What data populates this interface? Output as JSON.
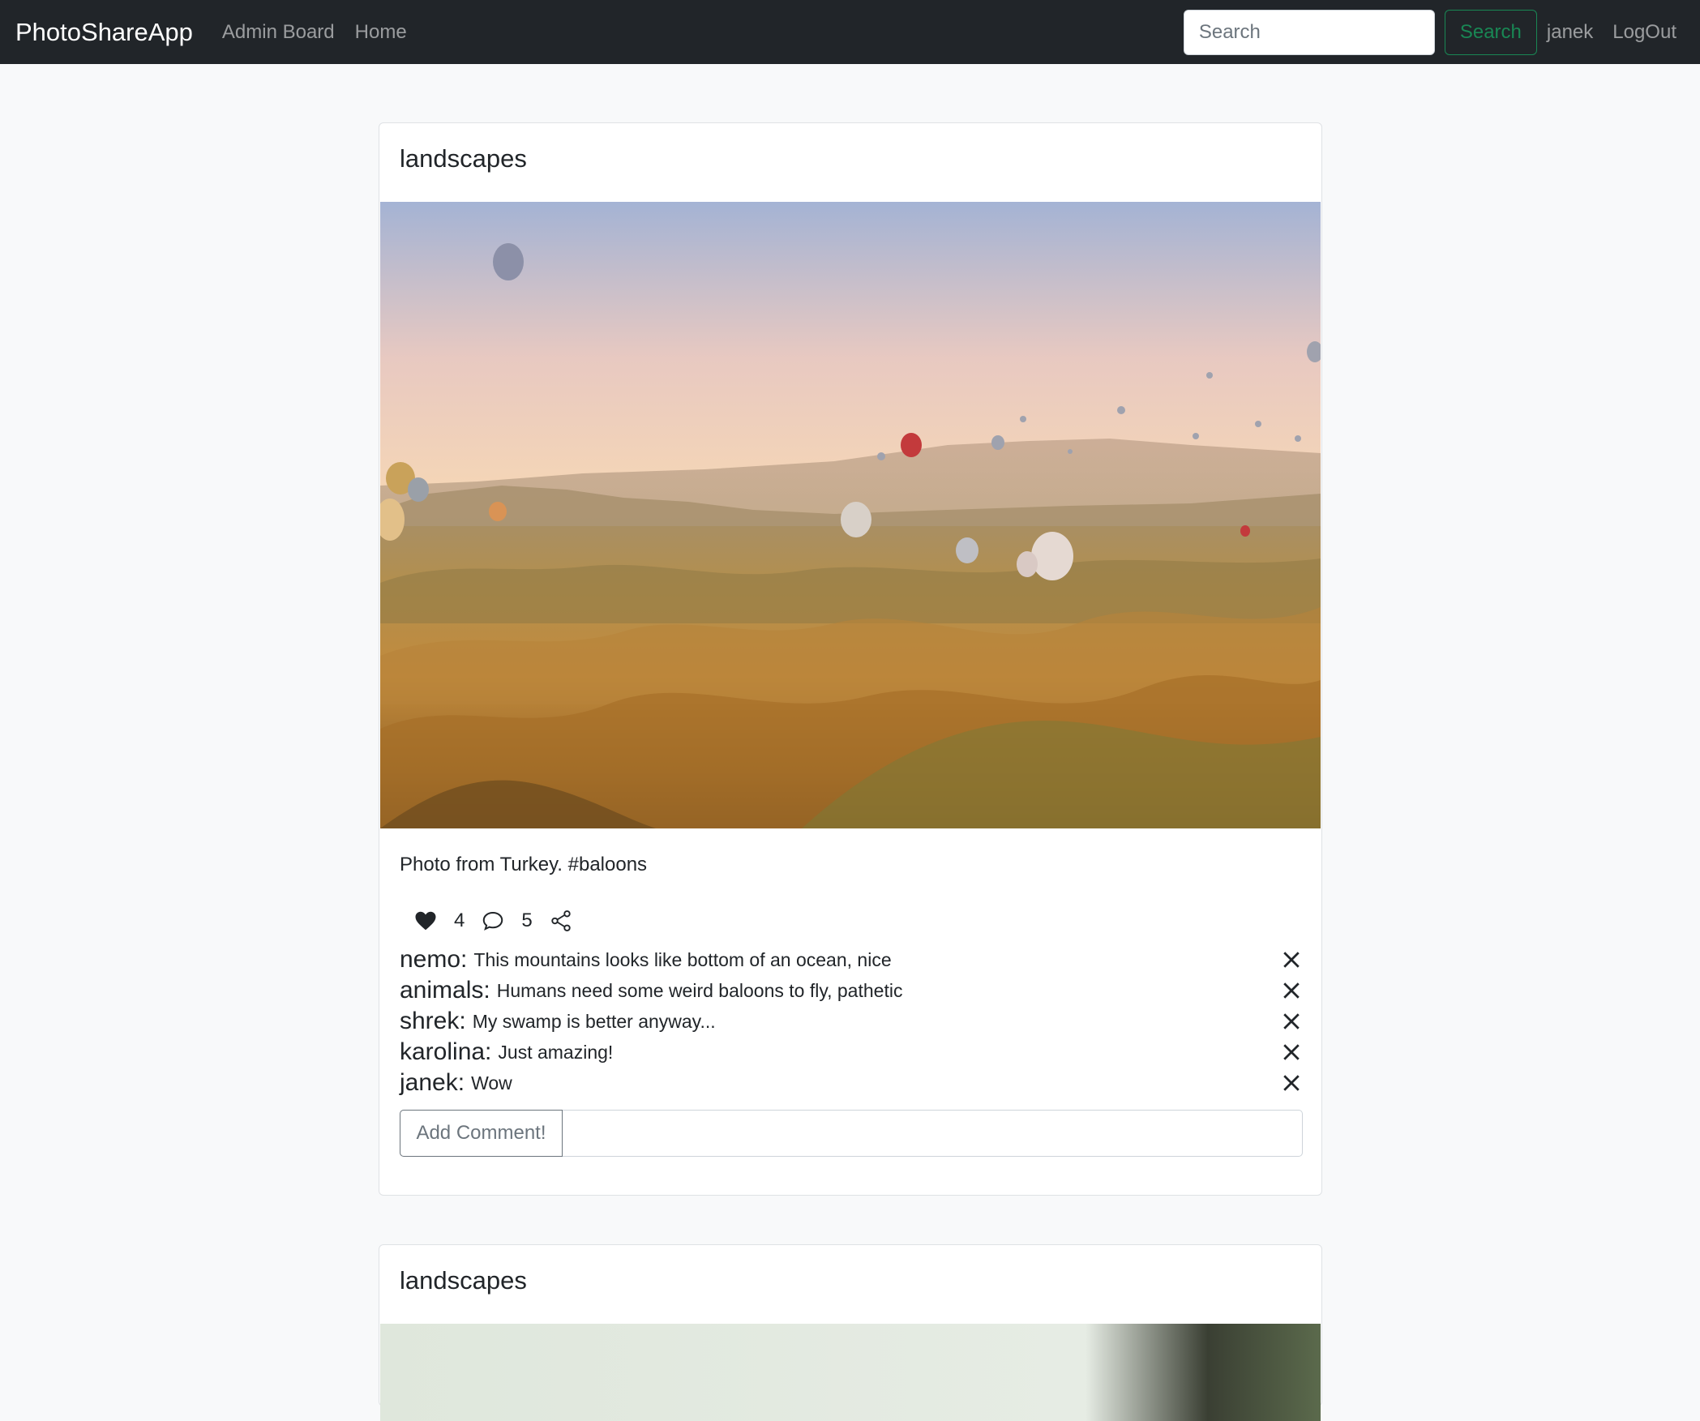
{
  "navbar": {
    "brand": "PhotoShareApp",
    "links": [
      "Admin Board",
      "Home"
    ],
    "search": {
      "placeholder": "Search",
      "value": "",
      "button_label": "Search"
    },
    "username": "janek",
    "logout_label": "LogOut"
  },
  "posts": [
    {
      "title": "landscapes",
      "description": "Photo from Turkey. #baloons",
      "likes": "4",
      "comment_count": "5",
      "comments": [
        {
          "user": "nemo:",
          "text": "This mountains looks like bottom of an ocean, nice"
        },
        {
          "user": "animals:",
          "text": "Humans need some weird baloons to fly, pathetic"
        },
        {
          "user": "shrek:",
          "text": "My swamp is better anyway..."
        },
        {
          "user": "karolina:",
          "text": "Just amazing!"
        },
        {
          "user": "janek:",
          "text": "Wow"
        }
      ],
      "add_comment": {
        "button_label": "Add Comment!",
        "value": ""
      }
    },
    {
      "title": "landscapes"
    }
  ],
  "icons": {
    "like": "heart-icon",
    "comment": "speech-bubble-icon",
    "share": "share-icon",
    "delete": "close-icon"
  },
  "colors": {
    "navbar_bg": "#212529",
    "search_button": "#198754",
    "page_bg": "#f8f9fa"
  }
}
